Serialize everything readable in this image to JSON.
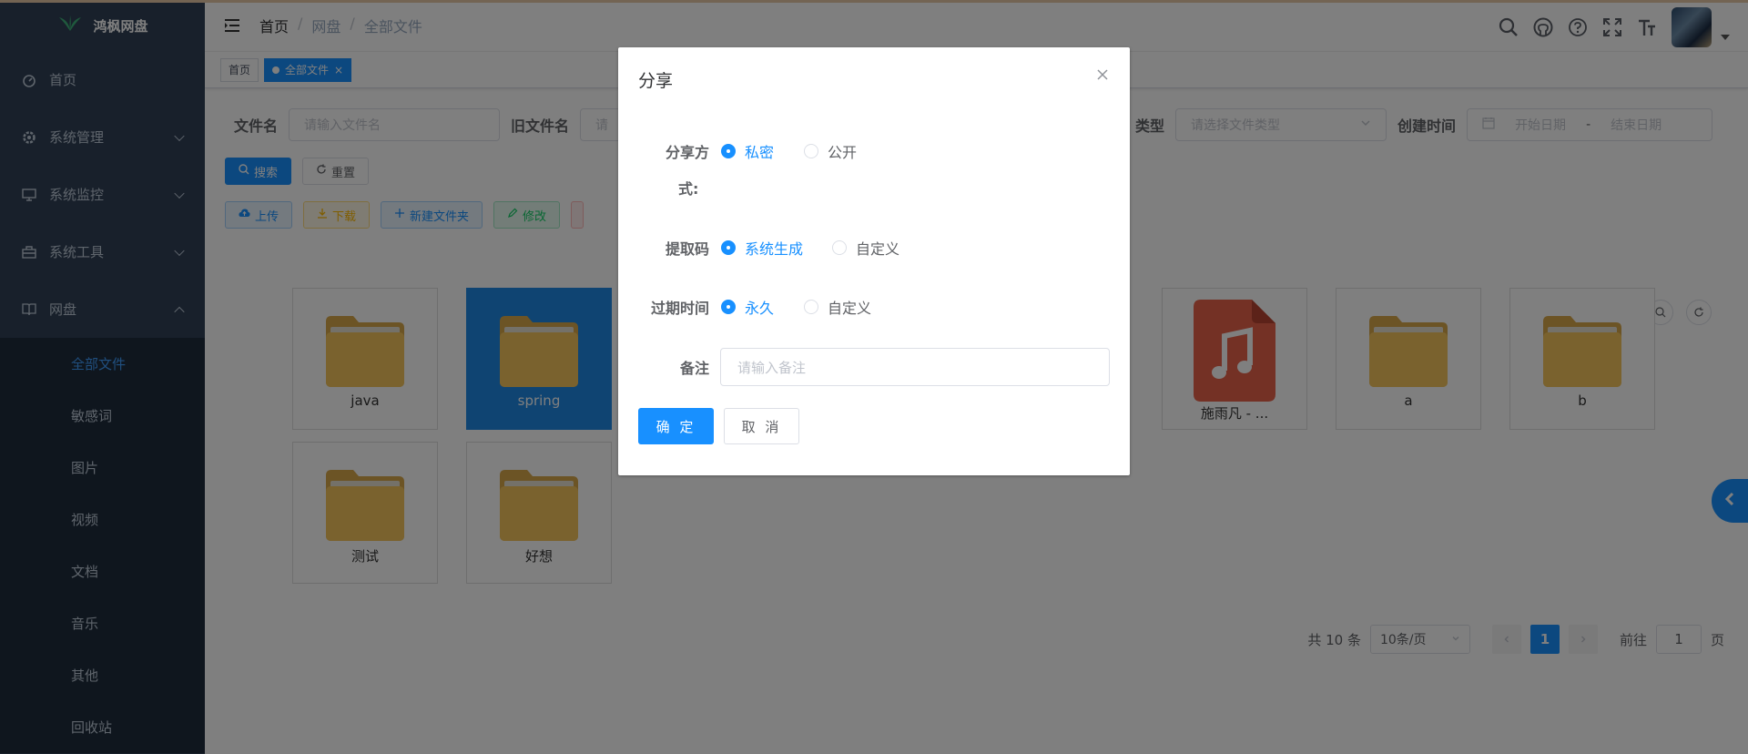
{
  "app": {
    "title": "鸿枫网盘"
  },
  "sidebar": {
    "items": [
      {
        "label": "首页",
        "icon": "dashboard-icon"
      },
      {
        "label": "系统管理",
        "icon": "gear-icon"
      },
      {
        "label": "系统监控",
        "icon": "monitor-icon"
      },
      {
        "label": "系统工具",
        "icon": "toolbox-icon"
      },
      {
        "label": "网盘",
        "icon": "book-icon"
      }
    ],
    "sub_items": [
      "全部文件",
      "敏感词",
      "图片",
      "视频",
      "文档",
      "音乐",
      "其他",
      "回收站"
    ],
    "active_sub": "全部文件"
  },
  "breadcrumb": [
    "首页",
    "网盘",
    "全部文件"
  ],
  "tags": {
    "home": "首页",
    "active": "全部文件",
    "close": "×"
  },
  "search": {
    "filename_label": "文件名",
    "filename_placeholder": "请输入文件名",
    "oldname_label": "旧文件名",
    "oldname_placeholder": "请",
    "type_label": "类型",
    "type_placeholder": "请选择文件类型",
    "created_label": "创建时间",
    "start_placeholder": "开始日期",
    "range_sep": "-",
    "end_placeholder": "结束日期",
    "search_btn": "搜索",
    "reset_btn": "重置"
  },
  "toolbar": {
    "upload": "上传",
    "download": "下载",
    "new_folder": "新建文件夹",
    "edit": "修改"
  },
  "files": [
    {
      "name": "java",
      "kind": "folder"
    },
    {
      "name": "spring",
      "kind": "folder",
      "selected": true
    },
    {
      "name": "施雨凡 - ...",
      "kind": "music"
    },
    {
      "name": "a",
      "kind": "folder"
    },
    {
      "name": "b",
      "kind": "folder"
    },
    {
      "name": "测试",
      "kind": "folder"
    },
    {
      "name": "好想",
      "kind": "folder"
    }
  ],
  "pagination": {
    "total": "共 10 条",
    "page_size": "10条/页",
    "current": "1",
    "goto": "前往",
    "goto_value": "1",
    "page_suffix": "页"
  },
  "dialog": {
    "title": "分享",
    "share_mode_label_1": "分享方",
    "share_mode_label_2": "式:",
    "share_private": "私密",
    "share_public": "公开",
    "code_label": "提取码",
    "code_system": "系统生成",
    "code_custom": "自定义",
    "expire_label": "过期时间",
    "expire_forever": "永久",
    "expire_custom": "自定义",
    "note_label": "备注",
    "note_placeholder": "请输入备注",
    "ok": "确 定",
    "cancel": "取 消"
  },
  "colors": {
    "primary": "#1890ff",
    "sidebar": "#304156",
    "folder": "#f5c45d",
    "music": "#e8624a"
  }
}
